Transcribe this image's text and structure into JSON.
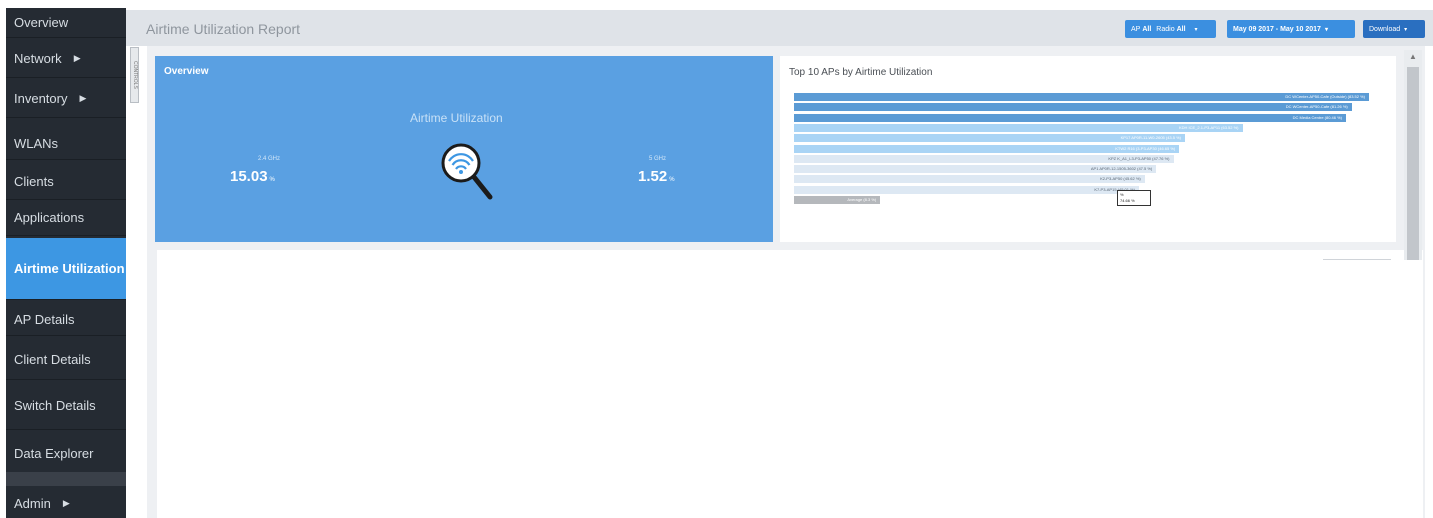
{
  "sidebar": {
    "items": [
      {
        "label": "Overview",
        "arrow": ""
      },
      {
        "label": "Network",
        "arrow": "▶"
      },
      {
        "label": "Inventory",
        "arrow": "▶"
      },
      {
        "label": "WLANs",
        "arrow": ""
      },
      {
        "label": "Clients",
        "arrow": ""
      },
      {
        "label": "Applications",
        "arrow": ""
      },
      {
        "label": "Airtime Utilization",
        "arrow": ""
      },
      {
        "label": "AP Details",
        "arrow": ""
      },
      {
        "label": "Client Details",
        "arrow": ""
      },
      {
        "label": "Switch Details",
        "arrow": ""
      },
      {
        "label": "Data Explorer",
        "arrow": ""
      },
      {
        "label": "Admin",
        "arrow": "▶"
      }
    ],
    "active_index": 6
  },
  "handle_label": "CONTROLS",
  "header": {
    "title": "Airtime Utilization Report",
    "ap_filter_label": "AP",
    "ap_filter_value": "All",
    "radio_filter_label": "Radio",
    "radio_filter_value": "All",
    "date_range": "May 09 2017 - May 10 2017",
    "download_label": "Download",
    "dropdown_glyph": "▾"
  },
  "overview": {
    "title": "Overview",
    "subtitle": "Airtime Utilization",
    "band_24_label": "2.4 GHz",
    "band_24_value": "15.03",
    "band_5_label": "5 GHz",
    "band_5_value": "1.52",
    "unit": "%",
    "icon": "wifi-search-icon"
  },
  "chart": {
    "title": "Top 10 APs by Airtime Utilization",
    "tooltip_line1": "%",
    "tooltip_line2": "74.66 %",
    "colors": {
      "dark": "#5b9bd5",
      "light": "#a9d4f5",
      "pale": "#dde8f3",
      "average": "#b5b8bc"
    }
  },
  "chart_data": {
    "type": "bar",
    "orientation": "horizontal",
    "title": "Top 10 APs by Airtime Utilization",
    "categories": [
      "DC WCenter-AP50-Cafe (Outside)",
      "DC WCenter-AP50-Cafe",
      "DC Media Centre",
      "KDH ICE_2.1-P3-AP11",
      "KP17 AP0R-11-W0-2605",
      "KTW2 R16 (3-P3-AP30",
      "KPZ K_A1_L3-P3-AP50",
      "AP1 AP0R-12-1505-3602",
      "K2-P3-AP50",
      "K7-P3-AP15",
      "Average"
    ],
    "labels": [
      "DC WCenter-AP50-Cafe (Outside) (83.52 %)",
      "DC WCenter-AP50-Cafe (81.26 %)",
      "DC Media Centre (80.46 %)",
      "KDH ICE_2.1-P3-AP11 (63.52 %)",
      "KP17 AP0R-11-W0-2605 (43.5 %)",
      "KTW2 R16 (3-P3-AP30 (46.65 %)",
      "KPZ K_A1_L3-P3-AP50 (47.76 %)",
      "AP1 AP0R-12-1505-3602 (47.5 %)",
      "K2-P3-AP50 (45.62 %)",
      "K7-P3-AP15 (45.01 %)",
      "Average (8.3 %)"
    ],
    "values": [
      83.52,
      81.26,
      80.46,
      63.52,
      43.5,
      46.65,
      47.76,
      47.5,
      45.62,
      45.01,
      8.3
    ],
    "bar_widths": [
      100,
      97,
      96,
      78,
      68,
      67,
      66,
      63,
      61,
      60,
      15
    ],
    "tiers": [
      "dark",
      "dark",
      "dark",
      "light",
      "light",
      "light",
      "pale",
      "pale",
      "pale",
      "pale",
      "average"
    ]
  }
}
